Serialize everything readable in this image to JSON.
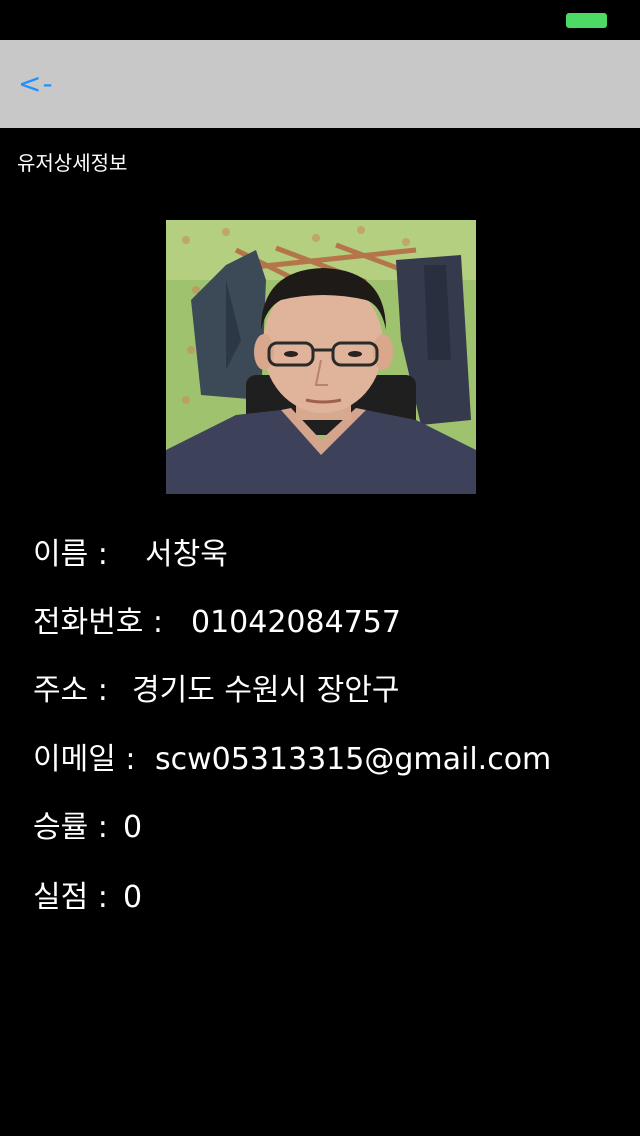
{
  "status_bar": {
    "battery_color": "#4cd964"
  },
  "nav": {
    "back_label": "<-",
    "back_color": "#1e90ff",
    "background": "#c8c8c8"
  },
  "page": {
    "title": "유저상세정보"
  },
  "profile": {
    "photo_icon": "user-photo",
    "name_label": "이름 :",
    "name_value": "서창욱",
    "phone_label": "전화번호 :",
    "phone_value": "01042084757",
    "address_label": "주소 :",
    "address_value": "경기도 수원시 장안구",
    "email_label": "이메일 :",
    "email_value": "scw05313315@gmail.com",
    "winrate_label": "승률 :",
    "winrate_value": "0",
    "record_label": "실점 :",
    "record_value": "0"
  }
}
